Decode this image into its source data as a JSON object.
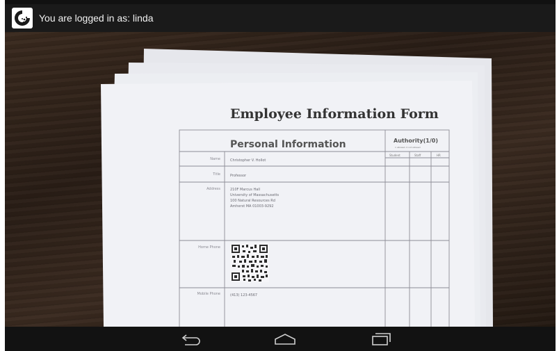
{
  "status_bar": {
    "login_text": "You are logged in as: linda"
  },
  "form": {
    "title": "Employee Information Form",
    "section_title": "Personal Information",
    "authority": {
      "title": "Authority(1/0)",
      "subtitle": "1 allowed, 0 not allowed",
      "columns": [
        "Student",
        "Staff",
        "HR"
      ]
    },
    "fields": [
      {
        "label": "Name",
        "value": "Christopher V. Hollot"
      },
      {
        "label": "Title",
        "value": "Professor"
      },
      {
        "label": "Address",
        "lines": [
          "210F Marcus Hall",
          "University of Massachusetts",
          "100 Natural Resources Rd",
          "Amherst MA 01003-9292"
        ]
      },
      {
        "label": "Home Phone",
        "value": ""
      },
      {
        "label": "Mobile Phone",
        "value": "(413) 123-4567"
      }
    ]
  },
  "nav": {
    "back": "back-icon",
    "home": "home-icon",
    "recents": "recent-apps-icon"
  },
  "colors": {
    "status_bar_bg": "#1a1a1a",
    "nav_bar_bg": "#121212",
    "paper": "#f1f2f6"
  }
}
